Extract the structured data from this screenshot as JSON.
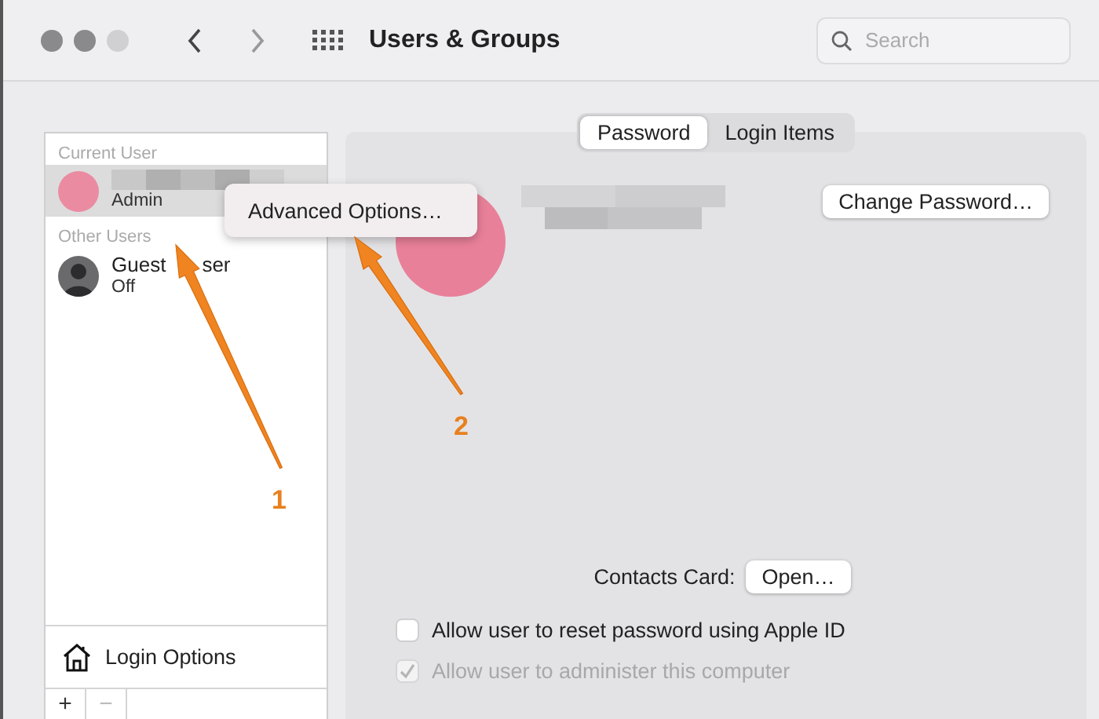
{
  "window": {
    "title": "Users & Groups"
  },
  "search": {
    "placeholder": "Search"
  },
  "sidebar": {
    "sections": [
      {
        "heading": "Current User",
        "users": [
          {
            "kind": "redacted",
            "subtitle": "Admin",
            "selected": true
          }
        ]
      },
      {
        "heading": "Other Users",
        "users": [
          {
            "kind": "guest",
            "name": "Guest",
            "name_rest": "ser",
            "subtitle": "Off",
            "selected": false
          }
        ]
      }
    ],
    "login_options": "Login Options",
    "buttons": [
      {
        "label": "+",
        "disabled": false
      },
      {
        "label": "−",
        "disabled": true
      }
    ]
  },
  "context_menu": {
    "items": [
      "Advanced Options…"
    ]
  },
  "tabs": [
    {
      "label": "Password",
      "selected": true
    },
    {
      "label": "Login Items",
      "selected": false
    }
  ],
  "profile": {
    "change_password": "Change Password…"
  },
  "contacts_card": {
    "label": "Contacts Card:",
    "button": "Open…"
  },
  "checkboxes": [
    {
      "label": "Allow user to reset password using Apple ID",
      "checked": false,
      "disabled": false
    },
    {
      "label": "Allow user to administer this computer",
      "checked": true,
      "disabled": true
    }
  ],
  "annotations": [
    {
      "label": "1"
    },
    {
      "label": "2"
    }
  ]
}
